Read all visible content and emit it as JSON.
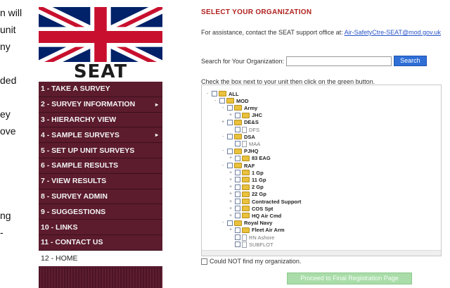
{
  "left_fragments": [
    "n will",
    "unit",
    "ny",
    "ded",
    "ey",
    "ove",
    "ng",
    "-"
  ],
  "brand": {
    "name": "SEAT"
  },
  "nav": {
    "items": [
      {
        "label": "1 - TAKE A SURVEY",
        "has_submenu": false
      },
      {
        "label": "2 - SURVEY INFORMATION",
        "has_submenu": true
      },
      {
        "label": "3 - HIERARCHY VIEW",
        "has_submenu": false
      },
      {
        "label": "4 - SAMPLE SURVEYS",
        "has_submenu": true
      },
      {
        "label": "5 - SET UP UNIT SURVEYS",
        "has_submenu": false
      },
      {
        "label": "6 - SAMPLE RESULTS",
        "has_submenu": false
      },
      {
        "label": "7 - VIEW RESULTS",
        "has_submenu": false
      },
      {
        "label": "8 - SURVEY ADMIN",
        "has_submenu": false
      },
      {
        "label": "9 - SUGGESTIONS",
        "has_submenu": false
      },
      {
        "label": "10 - LINKS",
        "has_submenu": false
      },
      {
        "label": "11 - CONTACT US",
        "has_submenu": false
      },
      {
        "label": "12 - HOME",
        "has_submenu": false,
        "active": true
      }
    ],
    "submenu_icon": "caret-right-icon"
  },
  "panel": {
    "title": "SELECT YOUR ORGANIZATION",
    "assist_text": "For assistance, contact the SEAT support office at:",
    "assist_link": "Air-SafetyCtre-SEAT@mod.gov.uk",
    "search_label": "Search for Your Organization:",
    "search_value": "",
    "search_button": "Search",
    "instructions": "Check the box next to your unit then click on the green button.",
    "not_found_label": "Could NOT find my organization.",
    "proceed_button": "Proceed to Final Registration Page"
  },
  "tree": [
    {
      "label": "ALL",
      "depth": 0,
      "type": "folder",
      "toggle": "-"
    },
    {
      "label": "MOD",
      "depth": 1,
      "type": "folder",
      "toggle": "-"
    },
    {
      "label": "Army",
      "depth": 2,
      "type": "folder",
      "toggle": "-"
    },
    {
      "label": "JHC",
      "depth": 3,
      "type": "folder",
      "toggle": "+"
    },
    {
      "label": "DE&S",
      "depth": 2,
      "type": "folder",
      "toggle": "+"
    },
    {
      "label": "DFS",
      "depth": 3,
      "type": "page",
      "toggle": ""
    },
    {
      "label": "DSA",
      "depth": 2,
      "type": "folder",
      "toggle": "-"
    },
    {
      "label": "MAA",
      "depth": 3,
      "type": "page",
      "toggle": ""
    },
    {
      "label": "PJHQ",
      "depth": 2,
      "type": "folder",
      "toggle": "-"
    },
    {
      "label": "83 EAG",
      "depth": 3,
      "type": "folder",
      "toggle": "+"
    },
    {
      "label": "RAF",
      "depth": 2,
      "type": "folder",
      "toggle": "-"
    },
    {
      "label": "1 Gp",
      "depth": 3,
      "type": "folder",
      "toggle": "+"
    },
    {
      "label": "11 Gp",
      "depth": 3,
      "type": "folder",
      "toggle": "+"
    },
    {
      "label": "2 Gp",
      "depth": 3,
      "type": "folder",
      "toggle": "+"
    },
    {
      "label": "22 Gp",
      "depth": 3,
      "type": "folder",
      "toggle": "+"
    },
    {
      "label": "Contracted Support",
      "depth": 3,
      "type": "folder",
      "toggle": "+"
    },
    {
      "label": "COS Spt",
      "depth": 3,
      "type": "folder",
      "toggle": "+"
    },
    {
      "label": "HQ Air Cmd",
      "depth": 3,
      "type": "folder",
      "toggle": "+"
    },
    {
      "label": "Royal Navy",
      "depth": 2,
      "type": "folder",
      "toggle": "-"
    },
    {
      "label": "Fleet Air Arm",
      "depth": 3,
      "type": "folder",
      "toggle": "+"
    },
    {
      "label": "RN Ashore",
      "depth": 3,
      "type": "page",
      "toggle": ""
    },
    {
      "label": "SUBFLOT",
      "depth": 3,
      "type": "page",
      "toggle": ""
    }
  ],
  "colors": {
    "nav_bg": "#5c1c2e",
    "title_red": "#b0201e",
    "link_blue": "#2a55c9",
    "search_blue": "#2f6fd6",
    "proceed_green": "#a9dca9",
    "folder_yellow": "#e9c13c"
  }
}
